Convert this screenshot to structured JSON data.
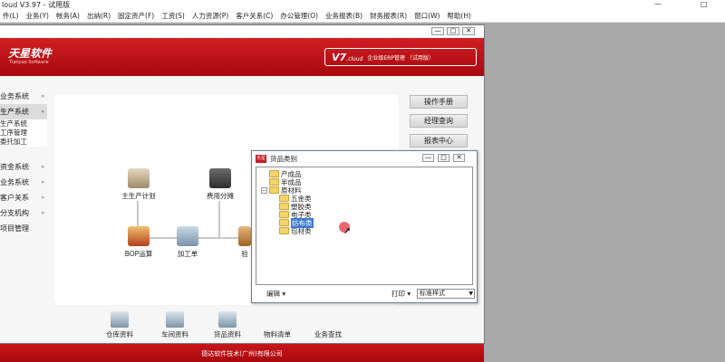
{
  "app": {
    "title": "loud V3.97 - 试用版",
    "window_controls": {
      "minimize": "—",
      "maximize": "□"
    }
  },
  "menu": [
    "件(L)",
    "业务(Y)",
    "帐务(A)",
    "出纳(R)",
    "固定资产(F)",
    "工资(S)",
    "人力资源(P)",
    "客户关系(C)",
    "办公管理(O)",
    "业务报表(B)",
    "财务报表(R)",
    "窗口(W)",
    "帮助(H)"
  ],
  "child_window": {
    "controls": [
      "—",
      "□",
      "✕"
    ]
  },
  "banner": {
    "logo": "天星软件",
    "logo_sub": "Tianyao Software",
    "version": "V7",
    "version_suffix": ".cloud",
    "edition": "企业级ERP管理 （试用版）",
    "color": "#b8090f"
  },
  "leftnav": {
    "groups_top": [
      {
        "label": "业务系统",
        "chev": "»"
      },
      {
        "label": "生产系统",
        "chev": "«"
      }
    ],
    "sub_items": [
      "生产系统",
      "工序管理",
      "委托加工"
    ],
    "groups_bottom": [
      {
        "label": "资金系统",
        "chev": "»"
      },
      {
        "label": "业务系统",
        "chev": "»"
      },
      {
        "label": "客户关系",
        "chev": "»"
      },
      {
        "label": "分支机构",
        "chev": "»"
      },
      {
        "label": "项目管理",
        "chev": ""
      }
    ]
  },
  "flow": {
    "nodes": [
      {
        "label": "主生产计划",
        "icon": "plan-icon"
      },
      {
        "label": "费用分摊",
        "icon": "calculator-icon"
      },
      {
        "label": "BOP运算",
        "icon": "mrp-icon"
      },
      {
        "label": "加工单",
        "icon": "work-order-icon"
      },
      {
        "label": "验",
        "icon": "inspection-icon"
      }
    ]
  },
  "right_buttons": [
    "操作手册",
    "经理查询",
    "报表中心"
  ],
  "bottom_toolbar": [
    "仓库资料",
    "车间资料",
    "货品资料",
    "物料清单",
    "业务查找"
  ],
  "footer": "德达软件技术(广州)有限公司",
  "dialog": {
    "title": "货品类别",
    "icon_text": "天星",
    "controls": [
      "—",
      "□",
      "✕"
    ],
    "tree": [
      {
        "label": "产成品",
        "level": 0,
        "toggle": ""
      },
      {
        "label": "半成品",
        "level": 0,
        "toggle": ""
      },
      {
        "label": "原材料",
        "level": 0,
        "toggle": "−"
      },
      {
        "label": "五金类",
        "level": 1,
        "toggle": ""
      },
      {
        "label": "塑胶类",
        "level": 1,
        "toggle": ""
      },
      {
        "label": "电子类",
        "level": 1,
        "toggle": ""
      },
      {
        "label": "纺布类",
        "level": 1,
        "toggle": "",
        "selected": true
      },
      {
        "label": "包材类",
        "level": 1,
        "toggle": ""
      }
    ],
    "edit_menu": "编辑 ▾",
    "print_label": "打印 ▾",
    "style_select": "标准样式",
    "selected_color": "#3a78d8"
  }
}
